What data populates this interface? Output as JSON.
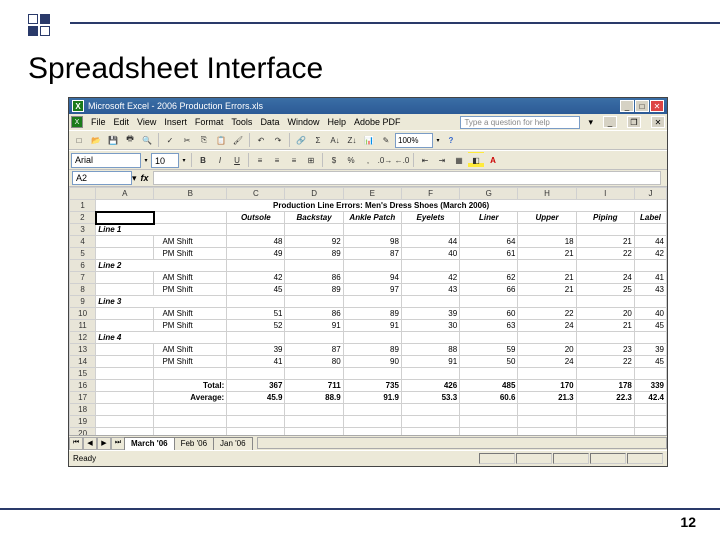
{
  "slide": {
    "title": "Spreadsheet Interface",
    "page_number": "12"
  },
  "app": {
    "title": "Microsoft Excel - 2006 Production Errors.xls",
    "menu": [
      "File",
      "Edit",
      "View",
      "Insert",
      "Format",
      "Tools",
      "Data",
      "Window",
      "Help",
      "Adobe PDF"
    ],
    "help_placeholder": "Type a question for help",
    "font": "Arial",
    "font_size": "10",
    "zoom": "100%",
    "name_box": "A2",
    "status": "Ready",
    "sheets": {
      "active": "March '06",
      "others": [
        "Feb '06",
        "Jan '06"
      ]
    }
  },
  "sheet": {
    "title": "Production Line Errors: Men's Dress Shoes (March 2006)",
    "columns": [
      "Outsole",
      "Backstay",
      "Ankle Patch",
      "Eyelets",
      "Liner",
      "Upper",
      "Piping",
      "Label"
    ],
    "groups": [
      {
        "name": "Line 1",
        "rows": [
          {
            "label": "AM Shift",
            "v": [
              48,
              92,
              98,
              44,
              64,
              18,
              21,
              44
            ]
          },
          {
            "label": "PM Shift",
            "v": [
              49,
              89,
              87,
              40,
              61,
              21,
              22,
              42
            ]
          }
        ]
      },
      {
        "name": "Line 2",
        "rows": [
          {
            "label": "AM Shift",
            "v": [
              42,
              86,
              94,
              42,
              62,
              21,
              24,
              41
            ]
          },
          {
            "label": "PM Shift",
            "v": [
              45,
              89,
              97,
              43,
              66,
              21,
              25,
              43
            ]
          }
        ]
      },
      {
        "name": "Line 3",
        "rows": [
          {
            "label": "AM Shift",
            "v": [
              51,
              86,
              89,
              39,
              60,
              22,
              20,
              40
            ]
          },
          {
            "label": "PM Shift",
            "v": [
              52,
              91,
              91,
              30,
              63,
              24,
              21,
              45
            ]
          }
        ]
      },
      {
        "name": "Line 4",
        "rows": [
          {
            "label": "AM Shift",
            "v": [
              39,
              87,
              89,
              88,
              59,
              20,
              23,
              39
            ]
          },
          {
            "label": "PM Shift",
            "v": [
              41,
              80,
              90,
              91,
              50,
              24,
              22,
              45
            ]
          }
        ]
      }
    ],
    "total": {
      "label": "Total:",
      "v": [
        367,
        711,
        735,
        426,
        485,
        170,
        178,
        339
      ]
    },
    "average": {
      "label": "Average:",
      "v": [
        45.9,
        88.9,
        91.9,
        53.3,
        60.6,
        21.3,
        22.3,
        42.4
      ]
    }
  },
  "chart_data": {
    "type": "table",
    "title": "Production Line Errors: Men's Dress Shoes (March 2006)",
    "categories": [
      "Outsole",
      "Backstay",
      "Ankle Patch",
      "Eyelets",
      "Liner",
      "Upper",
      "Piping",
      "Label"
    ],
    "series": [
      {
        "name": "Line 1 AM Shift",
        "values": [
          48,
          92,
          98,
          44,
          64,
          18,
          21,
          44
        ]
      },
      {
        "name": "Line 1 PM Shift",
        "values": [
          49,
          89,
          87,
          40,
          61,
          21,
          22,
          42
        ]
      },
      {
        "name": "Line 2 AM Shift",
        "values": [
          42,
          86,
          94,
          42,
          62,
          21,
          24,
          41
        ]
      },
      {
        "name": "Line 2 PM Shift",
        "values": [
          45,
          89,
          97,
          43,
          66,
          21,
          25,
          43
        ]
      },
      {
        "name": "Line 3 AM Shift",
        "values": [
          51,
          86,
          89,
          39,
          60,
          22,
          20,
          40
        ]
      },
      {
        "name": "Line 3 PM Shift",
        "values": [
          52,
          91,
          91,
          30,
          63,
          24,
          21,
          45
        ]
      },
      {
        "name": "Line 4 AM Shift",
        "values": [
          39,
          87,
          89,
          88,
          59,
          20,
          23,
          39
        ]
      },
      {
        "name": "Line 4 PM Shift",
        "values": [
          41,
          80,
          90,
          91,
          50,
          24,
          22,
          45
        ]
      },
      {
        "name": "Total",
        "values": [
          367,
          711,
          735,
          426,
          485,
          170,
          178,
          339
        ]
      },
      {
        "name": "Average",
        "values": [
          45.9,
          88.9,
          91.9,
          53.3,
          60.6,
          21.3,
          22.3,
          42.4
        ]
      }
    ]
  }
}
